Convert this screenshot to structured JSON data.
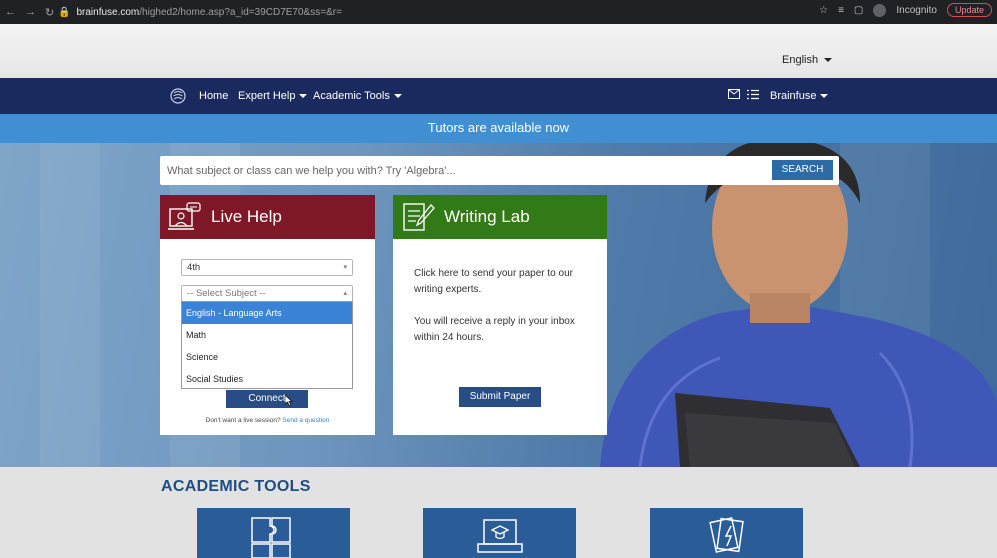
{
  "browser": {
    "url_host": "brainfuse.com",
    "url_path": "/highed2/home.asp?a_id=39CD7E70&ss=&r=",
    "profile_label": "Incognito",
    "update_label": "Update",
    "nav_icons": [
      "back-icon",
      "forward-icon",
      "reload-icon"
    ]
  },
  "language": {
    "selected": "English"
  },
  "navbar": {
    "home": "Home",
    "expert_help": "Expert Help",
    "academic_tools": "Academic Tools",
    "account": "Brainfuse"
  },
  "banner": {
    "text": "Tutors are available now"
  },
  "search": {
    "placeholder": "What subject or class can we help you with? Try 'Algebra'...",
    "button": "SEARCH"
  },
  "live_help": {
    "title": "Live Help",
    "grade_value": "4th",
    "subject_placeholder": "-- Select Subject --",
    "subject_options": [
      "English - Language Arts",
      "Math",
      "Science",
      "Social Studies"
    ],
    "highlighted_option": "English - Language Arts",
    "connect": "Connect",
    "footer_text": "Don't want a live session?",
    "footer_link": "Send a question"
  },
  "writing_lab": {
    "title": "Writing Lab",
    "line1": "Click here to send your paper to our",
    "line2": "writing experts.",
    "line3": "You will receive a reply in your inbox",
    "line4": "within 24 hours.",
    "submit": "Submit Paper"
  },
  "academic_tools": {
    "title": "ACADEMIC TOOLS",
    "tiles": [
      "puzzle-icon",
      "graduation-book-icon",
      "flashcards-icon"
    ]
  },
  "colors": {
    "navbar": "#1b2a5e",
    "banner": "#3f8fd2",
    "live_help": "#7e1726",
    "writing_lab": "#327a17",
    "button": "#274d84",
    "tools_title": "#1f4e86"
  }
}
